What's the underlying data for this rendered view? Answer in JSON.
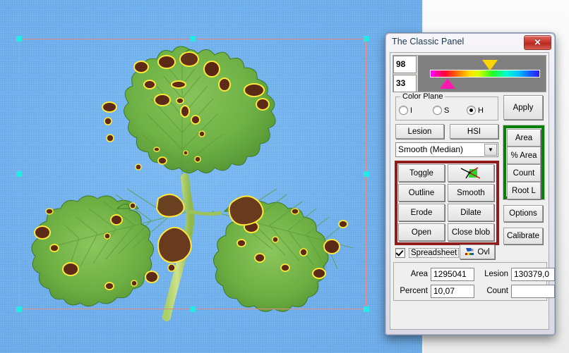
{
  "window": {
    "title": "The Classic Panel",
    "close_label": "✕"
  },
  "threshold": {
    "high_value": "98",
    "low_value": "33",
    "high_marker_icon": "down-triangle-marker",
    "low_marker_icon": "up-triangle-marker",
    "hue_bar_icon": "hue-gradient-bar"
  },
  "color_plane": {
    "legend": "Color Plane",
    "options": [
      {
        "label": "I",
        "selected": false
      },
      {
        "label": "S",
        "selected": false
      },
      {
        "label": "H",
        "selected": true
      }
    ]
  },
  "actions": {
    "apply": "Apply",
    "lesion": "Lesion",
    "hsi": "HSI",
    "options": "Options",
    "calibrate": "Calibrate"
  },
  "filter": {
    "selected": "Smooth (Median)",
    "arrow_icon": "chevron-down-icon"
  },
  "morphology": {
    "buttons": [
      {
        "label": "Toggle",
        "icon": ""
      },
      {
        "label": "",
        "icon": "arrow-blob-icon"
      },
      {
        "label": "Outline",
        "icon": ""
      },
      {
        "label": "Smooth",
        "icon": ""
      },
      {
        "label": "Erode",
        "icon": ""
      },
      {
        "label": "Dilate",
        "icon": ""
      },
      {
        "label": "Open",
        "icon": ""
      },
      {
        "label": "Close blob",
        "icon": ""
      }
    ],
    "frame_color": "#8f1d1d"
  },
  "measure": {
    "buttons": [
      {
        "label": "Area"
      },
      {
        "label": "% Area"
      },
      {
        "label": "Count"
      },
      {
        "label": "Root L"
      }
    ],
    "frame_color": "#087f08"
  },
  "overlay": {
    "spreadsheet_label": "Spreadsheet",
    "spreadsheet_checked": true,
    "ovl_label": "Ovl",
    "ovl_icon": "overlay-paint-icon"
  },
  "results": {
    "area_label": "Area",
    "area_value": "1295041",
    "lesion_label": "Lesion",
    "lesion_value": "130379,0",
    "percent_label": "Percent",
    "percent_value": "10,07",
    "count_label": "Count",
    "count_value": ""
  },
  "image": {
    "subject": "strawberry-leaf-with-lesions",
    "background_color": "#73b3ef",
    "selection_border_color": "#e98b7e",
    "handle_color": "#25e8e8"
  }
}
